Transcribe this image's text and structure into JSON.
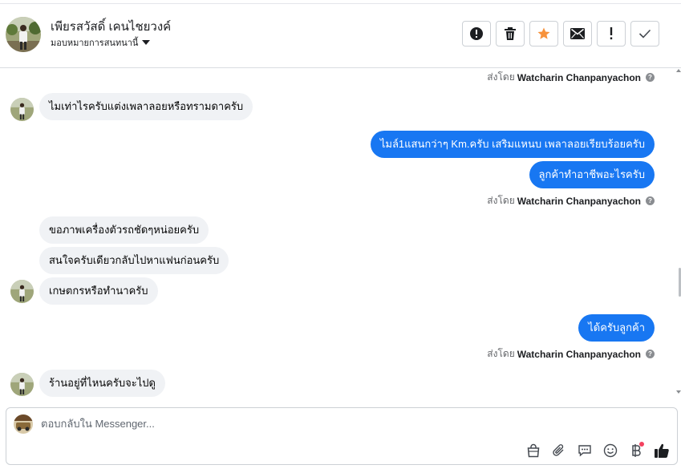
{
  "header": {
    "name": "เพียรสวัสดิ์ เคนไชยวงค์",
    "assign_label": "มอบหมายการสนทนานี้"
  },
  "actions": [
    {
      "name": "spam-button",
      "icon": "alert-circle-icon"
    },
    {
      "name": "delete-button",
      "icon": "trash-icon"
    },
    {
      "name": "star-button",
      "icon": "star-icon",
      "color": "#f7923b"
    },
    {
      "name": "mark-unread-button",
      "icon": "envelope-icon"
    },
    {
      "name": "follow-up-button",
      "icon": "exclamation-icon"
    },
    {
      "name": "done-button",
      "icon": "checkmark-icon"
    }
  ],
  "messages": {
    "sent_by_prefix": "ส่งโดย",
    "sender_name": "Watcharin Chanpanyachon",
    "m1": "ไมเท่าไรครับแต่งเพลาลอยหรือทรามดาครับ",
    "m2": "ไมล์1แสนกว่าๆ Km.ครับ เสริมแหนบ เพลาลอยเรียบร้อยครับ",
    "m3": "ลูกค้าทำอาชีพอะไรครับ",
    "m4": "ขอภาพเครื่องตัวรถชัดๆหน่อยครับ",
    "m5": "สนใจครับเดียวกลับไปหาแฟนก่อนครับ",
    "m6": "เกษตกรหรือทำนาครับ",
    "m7": "ได้ครับลูกค้า",
    "m8": "ร้านอยู่ที่ไหนครับจะไปดู"
  },
  "composer": {
    "placeholder": "ตอบกลับใน Messenger..."
  },
  "colors": {
    "outgoing_bubble": "#1877f2",
    "incoming_bubble": "#f0f2f5",
    "like": "#1c1e21"
  }
}
